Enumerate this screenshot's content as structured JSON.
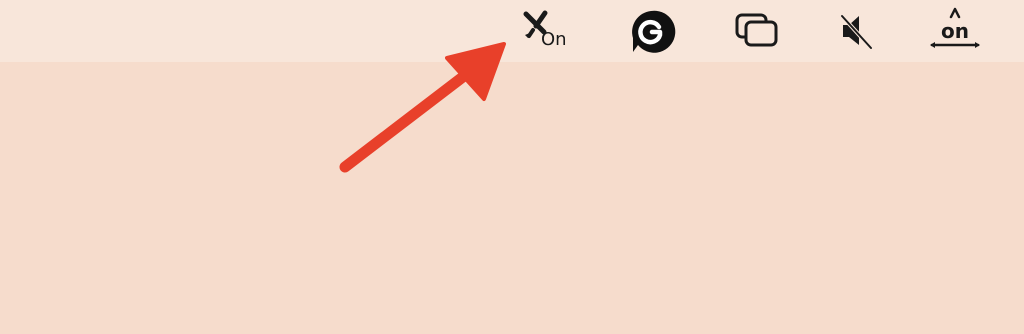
{
  "menubar": {
    "items": [
      {
        "name": "caption-on-icon",
        "label": "On"
      },
      {
        "name": "grammarly-icon",
        "label": ""
      },
      {
        "name": "window-overlap-icon",
        "label": ""
      },
      {
        "name": "speaker-muted-icon",
        "label": ""
      },
      {
        "name": "language-on-icon",
        "label": "on",
        "glyph": "A"
      }
    ]
  },
  "colors": {
    "menubar_bg": "#f8e6da",
    "content_bg": "#f6dccc",
    "icon": "#1a1a1a",
    "arrow": "#e8402a"
  }
}
